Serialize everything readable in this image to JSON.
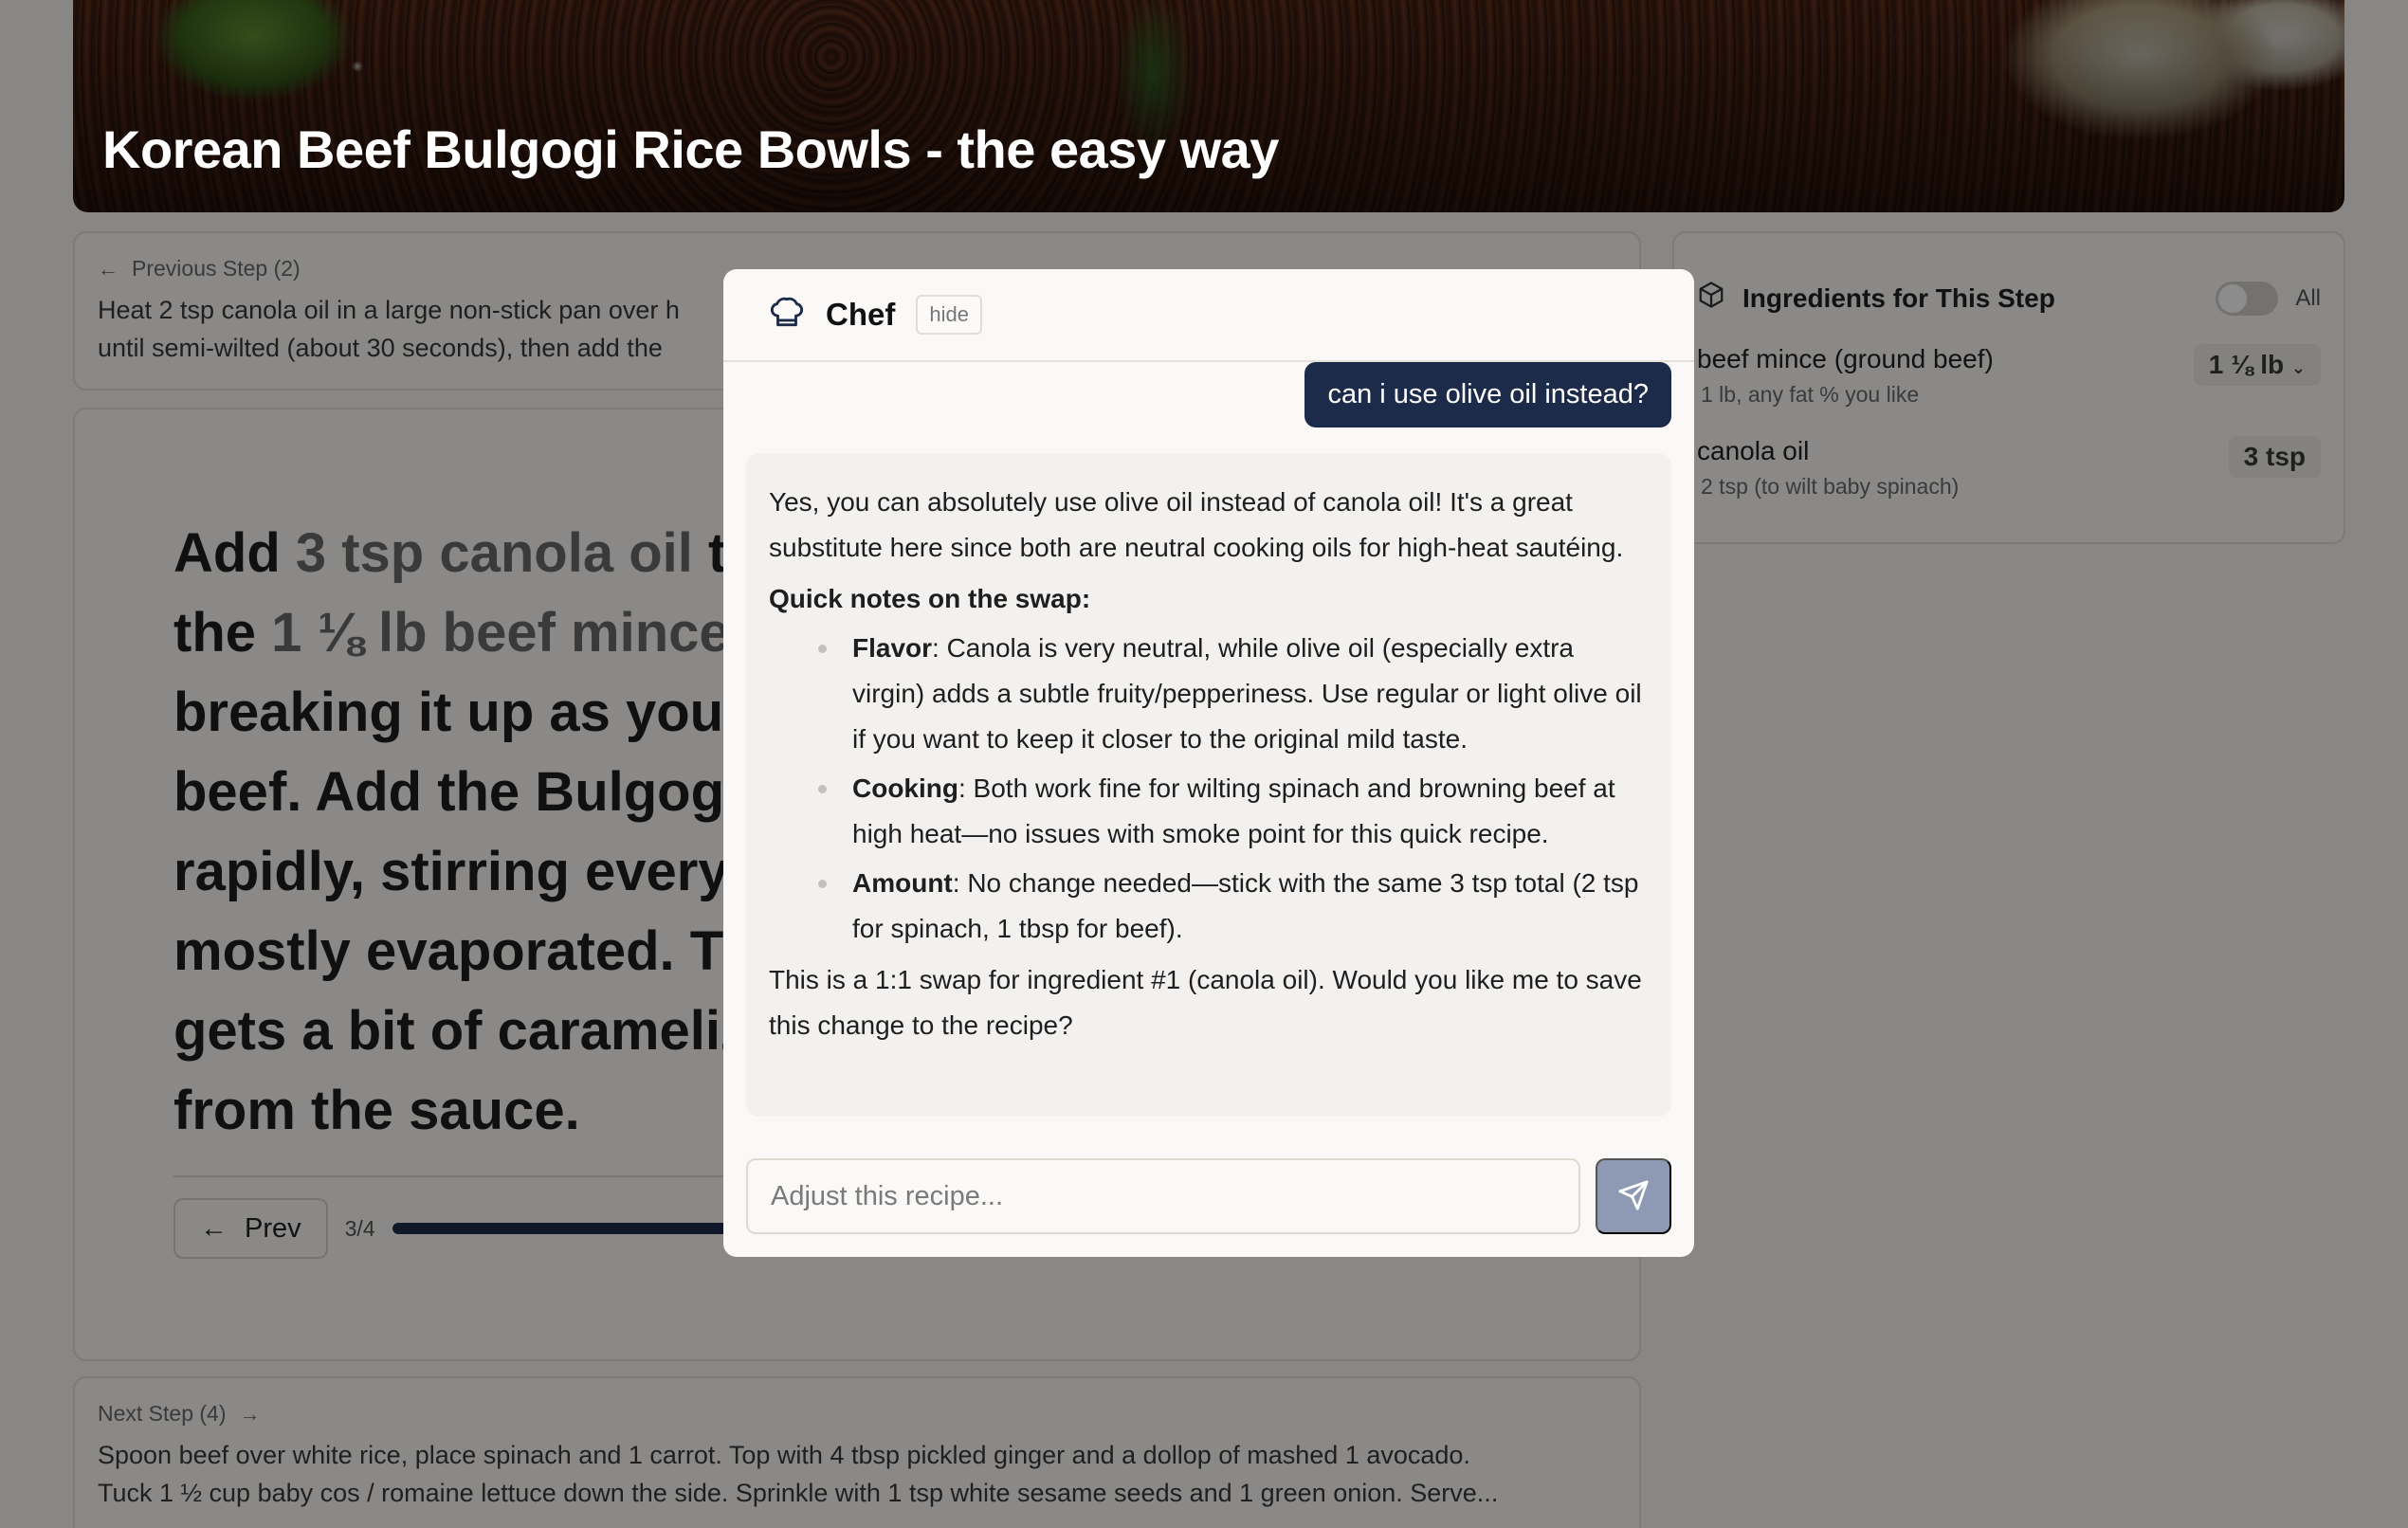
{
  "recipe": {
    "title": "Korean Beef Bulgogi Rice Bowls - the easy way"
  },
  "previous_step": {
    "label": "Previous Step (2)",
    "text": "Heat 2 tsp canola oil in a large non-stick pan over h",
    "text_line2": "until semi-wilted (about 30 seconds), then add the"
  },
  "current_step": {
    "text_parts": [
      "Add ",
      "3 tsp canola oil",
      " to",
      "the ",
      "1 ⅛ lb beef mince",
      "breaking it up as you g",
      "beef. Add the Bulgogi",
      "rapidly, stirring every r",
      "mostly evaporated. Th",
      "gets a bit of carameliz",
      "from the sauce."
    ],
    "prev_label": "Prev",
    "counter": "3/4",
    "progress": 0.75
  },
  "next_step": {
    "label": "Next Step (4)",
    "line1": "Spoon beef over white rice, place spinach and 1 carrot. Top with 4 tbsp pickled ginger and a dollop of mashed 1 avocado.",
    "line2": "Tuck 1 ½ cup baby cos / romaine lettuce down the side. Sprinkle with 1 tsp white sesame seeds and 1 green onion. Serve..."
  },
  "ingredients_panel": {
    "title": "Ingredients for This Step",
    "all_label": "All",
    "items": [
      {
        "name": "beef mince (ground beef)",
        "note": "1 lb, any fat % you like",
        "qty": "1 ⅛ lb"
      },
      {
        "name": "canola oil",
        "note": "2 tsp (to wilt baby spinach)",
        "qty": "3 tsp"
      }
    ]
  },
  "chef_modal": {
    "title": "Chef",
    "hide_label": "hide",
    "user_message": "can i use olive oil instead?",
    "reply": {
      "intro": "Yes, you can absolutely use olive oil instead of canola oil! It's a great substitute here since both are neutral cooking oils for high-heat sautéing.",
      "notes_heading": "Quick notes on the swap:",
      "bullets": [
        {
          "term": "Flavor",
          "text": ": Canola is very neutral, while olive oil (especially extra virgin) adds a subtle fruity/pepperiness. Use regular or light olive oil if you want to keep it closer to the original mild taste."
        },
        {
          "term": "Cooking",
          "text": ": Both work fine for wilting spinach and browning beef at high heat—no issues with smoke point for this quick recipe."
        },
        {
          "term": "Amount",
          "text": ": No change needed—stick with the same 3 tsp total (2 tsp for spinach, 1 tbsp for beef)."
        }
      ],
      "closing": "This is a 1:1 swap for ingredient #1 (canola oil). Would you like me to save this change to the recipe?"
    },
    "input_placeholder": "Adjust this recipe...",
    "input_value": ""
  },
  "icons": {
    "chef": "chef-hat-icon",
    "send": "send-icon",
    "ingredients": "package-icon",
    "prev": "arrow-left-icon",
    "next": "arrow-right-icon",
    "chevron": "chevron-down-icon"
  },
  "colors": {
    "accent": "#1d2b4a",
    "send_button": "#8e9ab3"
  }
}
